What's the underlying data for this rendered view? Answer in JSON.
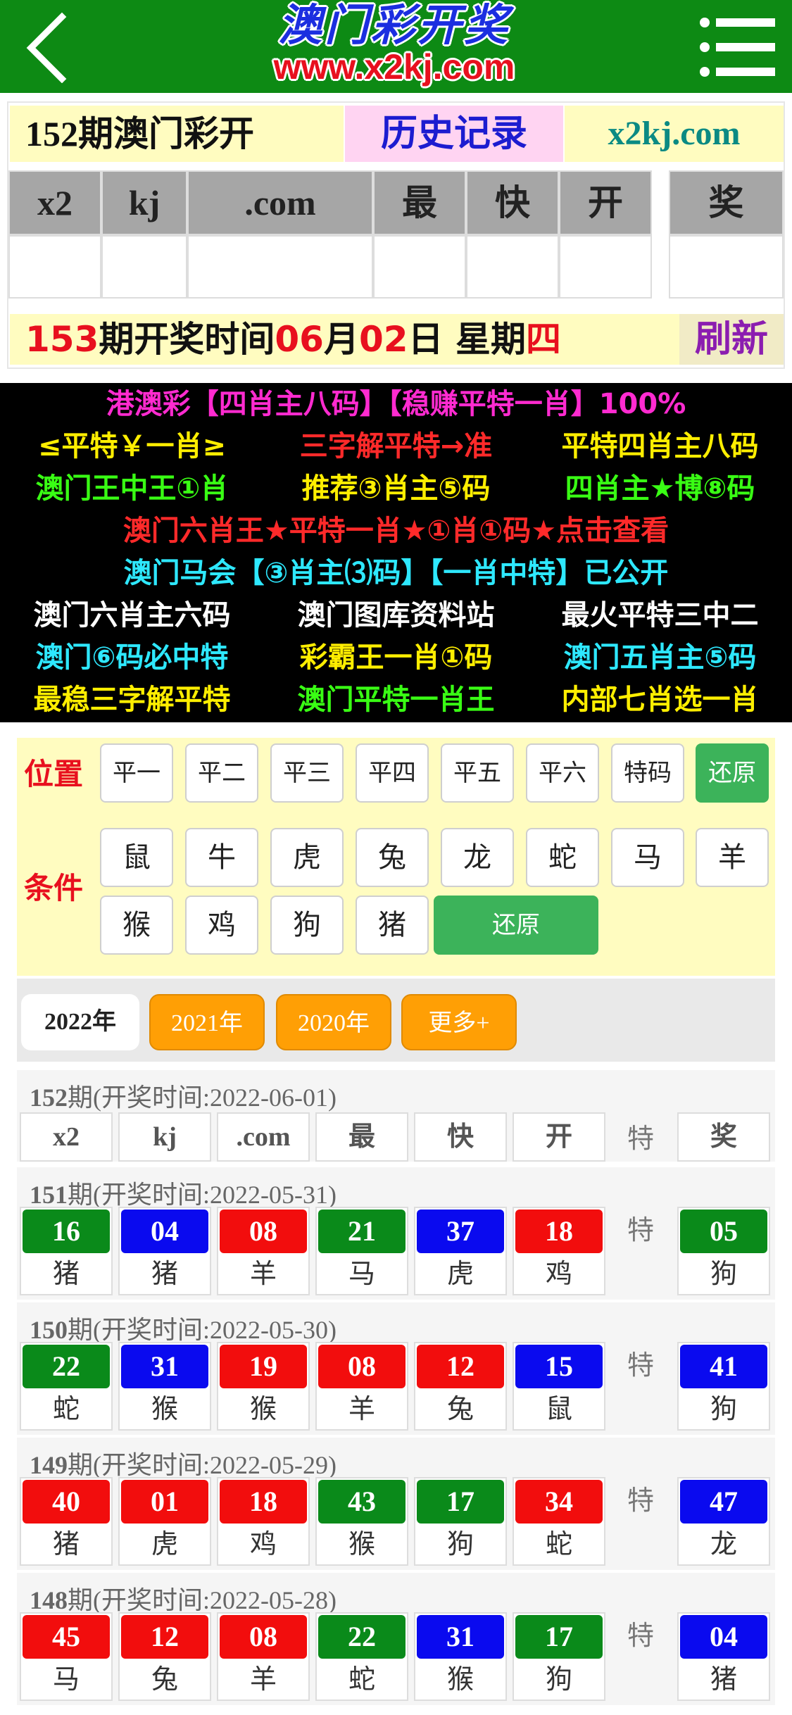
{
  "header": {
    "brand_title": "澳门彩开奖",
    "brand_url": "www.x2kj.com"
  },
  "result": {
    "title": "152期澳门彩开",
    "history_link": "历史记录",
    "site": "x2kj.com",
    "ball_headers": [
      "x2",
      "kj",
      ".com",
      "最",
      "快",
      "开"
    ],
    "special_header": "奖",
    "next_draw": {
      "issue": "153",
      "issue_suffix": "期开奖时间",
      "month": "06",
      "month_label": "月",
      "day": "02",
      "day_label": "日 星期",
      "weekday": "四"
    },
    "refresh": "刷新"
  },
  "promo": {
    "line1": "港澳彩【四肖主八码】【稳赚平特一肖】100%",
    "line1_color": "#ff2bd0",
    "row1": [
      {
        "text": "≤平特￥一肖≥",
        "color": "#ffee00"
      },
      {
        "text": "三字解平特→准",
        "color": "#ff2a2a"
      },
      {
        "text": "平特四肖主八码",
        "color": "#ffee00"
      }
    ],
    "row2": [
      {
        "text": "澳门王中王①肖",
        "color": "#39ff14"
      },
      {
        "text": "推荐③肖主⑤码",
        "color": "#ffee00"
      },
      {
        "text": "四肖主★博⑧码",
        "color": "#39ff14"
      }
    ],
    "line2": "澳门六肖王★平特一肖★①肖①码★点击查看",
    "line2_color": "#ff2a2a",
    "line3": "澳门马会【③肖主⑶码】【一肖中特】已公开",
    "line3_color": "#2ee8ff",
    "row3": [
      {
        "text": "澳门六肖主六码",
        "color": "#ffffff"
      },
      {
        "text": "澳门图库资料站",
        "color": "#ffffff"
      },
      {
        "text": "最火平特三中二",
        "color": "#ffffff"
      }
    ],
    "row4": [
      {
        "text": "澳门⑥码必中特",
        "color": "#2ee8ff"
      },
      {
        "text": "彩霸王一肖①码",
        "color": "#ffee00"
      },
      {
        "text": "澳门五肖主⑤码",
        "color": "#2ee8ff"
      }
    ],
    "row5": [
      {
        "text": "最稳三字解平特",
        "color": "#ffee00"
      },
      {
        "text": "澳门平特一肖王",
        "color": "#39ff14"
      },
      {
        "text": "内部七肖选一肖",
        "color": "#ffee00"
      }
    ]
  },
  "filter": {
    "position_label": "位置",
    "condition_label": "条件",
    "positions": [
      "平一",
      "平二",
      "平三",
      "平四",
      "平五",
      "平六",
      "特码"
    ],
    "position_reset": "还原",
    "zodiac_row1": [
      "鼠",
      "牛",
      "虎",
      "兔",
      "龙",
      "蛇",
      "马",
      "羊"
    ],
    "zodiac_row2": [
      "猴",
      "鸡",
      "狗",
      "猪"
    ],
    "condition_reset": "还原"
  },
  "years": [
    "2022年",
    "2021年",
    "2020年",
    "更多+"
  ],
  "te_label": "特",
  "colors": {
    "red": "#f20d0d",
    "blue": "#0a0aef",
    "green": "#0a8a1a"
  },
  "records": [
    {
      "issue": "152",
      "date_text": "期(开奖时间:2022-06-01)",
      "headers": [
        "x2",
        "kj",
        ".com",
        "最",
        "快",
        "开"
      ],
      "special_header": "奖"
    },
    {
      "issue": "151",
      "date_text": "期(开奖时间:2022-05-31)",
      "balls": [
        {
          "num": "16",
          "animal": "猪",
          "color": "green"
        },
        {
          "num": "04",
          "animal": "猪",
          "color": "blue"
        },
        {
          "num": "08",
          "animal": "羊",
          "color": "red"
        },
        {
          "num": "21",
          "animal": "马",
          "color": "green"
        },
        {
          "num": "37",
          "animal": "虎",
          "color": "blue"
        },
        {
          "num": "18",
          "animal": "鸡",
          "color": "red"
        }
      ],
      "special": {
        "num": "05",
        "animal": "狗",
        "color": "green"
      }
    },
    {
      "issue": "150",
      "date_text": "期(开奖时间:2022-05-30)",
      "balls": [
        {
          "num": "22",
          "animal": "蛇",
          "color": "green"
        },
        {
          "num": "31",
          "animal": "猴",
          "color": "blue"
        },
        {
          "num": "19",
          "animal": "猴",
          "color": "red"
        },
        {
          "num": "08",
          "animal": "羊",
          "color": "red"
        },
        {
          "num": "12",
          "animal": "兔",
          "color": "red"
        },
        {
          "num": "15",
          "animal": "鼠",
          "color": "blue"
        }
      ],
      "special": {
        "num": "41",
        "animal": "狗",
        "color": "blue"
      }
    },
    {
      "issue": "149",
      "date_text": "期(开奖时间:2022-05-29)",
      "balls": [
        {
          "num": "40",
          "animal": "猪",
          "color": "red"
        },
        {
          "num": "01",
          "animal": "虎",
          "color": "red"
        },
        {
          "num": "18",
          "animal": "鸡",
          "color": "red"
        },
        {
          "num": "43",
          "animal": "猴",
          "color": "green"
        },
        {
          "num": "17",
          "animal": "狗",
          "color": "green"
        },
        {
          "num": "34",
          "animal": "蛇",
          "color": "red"
        }
      ],
      "special": {
        "num": "47",
        "animal": "龙",
        "color": "blue"
      }
    },
    {
      "issue": "148",
      "date_text": "期(开奖时间:2022-05-28)",
      "balls": [
        {
          "num": "45",
          "animal": "马",
          "color": "red"
        },
        {
          "num": "12",
          "animal": "兔",
          "color": "red"
        },
        {
          "num": "08",
          "animal": "羊",
          "color": "red"
        },
        {
          "num": "22",
          "animal": "蛇",
          "color": "green"
        },
        {
          "num": "31",
          "animal": "猴",
          "color": "blue"
        },
        {
          "num": "17",
          "animal": "狗",
          "color": "green"
        }
      ],
      "special": {
        "num": "04",
        "animal": "猪",
        "color": "blue"
      }
    }
  ]
}
